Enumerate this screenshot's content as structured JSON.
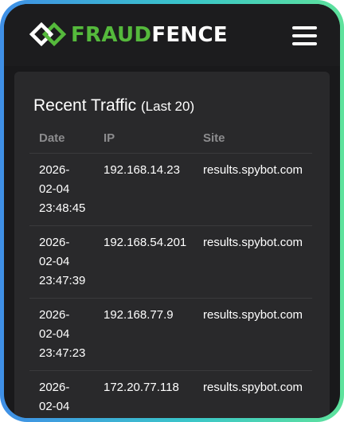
{
  "header": {
    "brand_part1": "FRAUD",
    "brand_part2": "FENCE",
    "logo_icon": "interlocked-diamonds-icon",
    "menu_icon": "hamburger-menu-icon"
  },
  "card": {
    "title": "Recent Traffic",
    "subtitle": "(Last 20)"
  },
  "table": {
    "columns": [
      "Date",
      "IP",
      "Site"
    ],
    "rows": [
      {
        "date_line1": "2026-",
        "date_line2": "02-04",
        "date_line3": "23:48:45",
        "ip": "192.168.14.23",
        "site": "results.spybot.com"
      },
      {
        "date_line1": "2026-",
        "date_line2": "02-04",
        "date_line3": "23:47:39",
        "ip": "192.168.54.201",
        "site": "results.spybot.com"
      },
      {
        "date_line1": "2026-",
        "date_line2": "02-04",
        "date_line3": "23:47:23",
        "ip": "192.168.77.9",
        "site": "results.spybot.com"
      },
      {
        "date_line1": "2026-",
        "date_line2": "02-04",
        "date_line3": "",
        "ip": "172.20.77.118",
        "site": "results.spybot.com"
      }
    ]
  },
  "colors": {
    "brand_green": "#55b93c",
    "frame_blue": "#3f8fe6",
    "frame_green": "#5ee29c",
    "background": "#19191b",
    "card": "#29292b"
  }
}
